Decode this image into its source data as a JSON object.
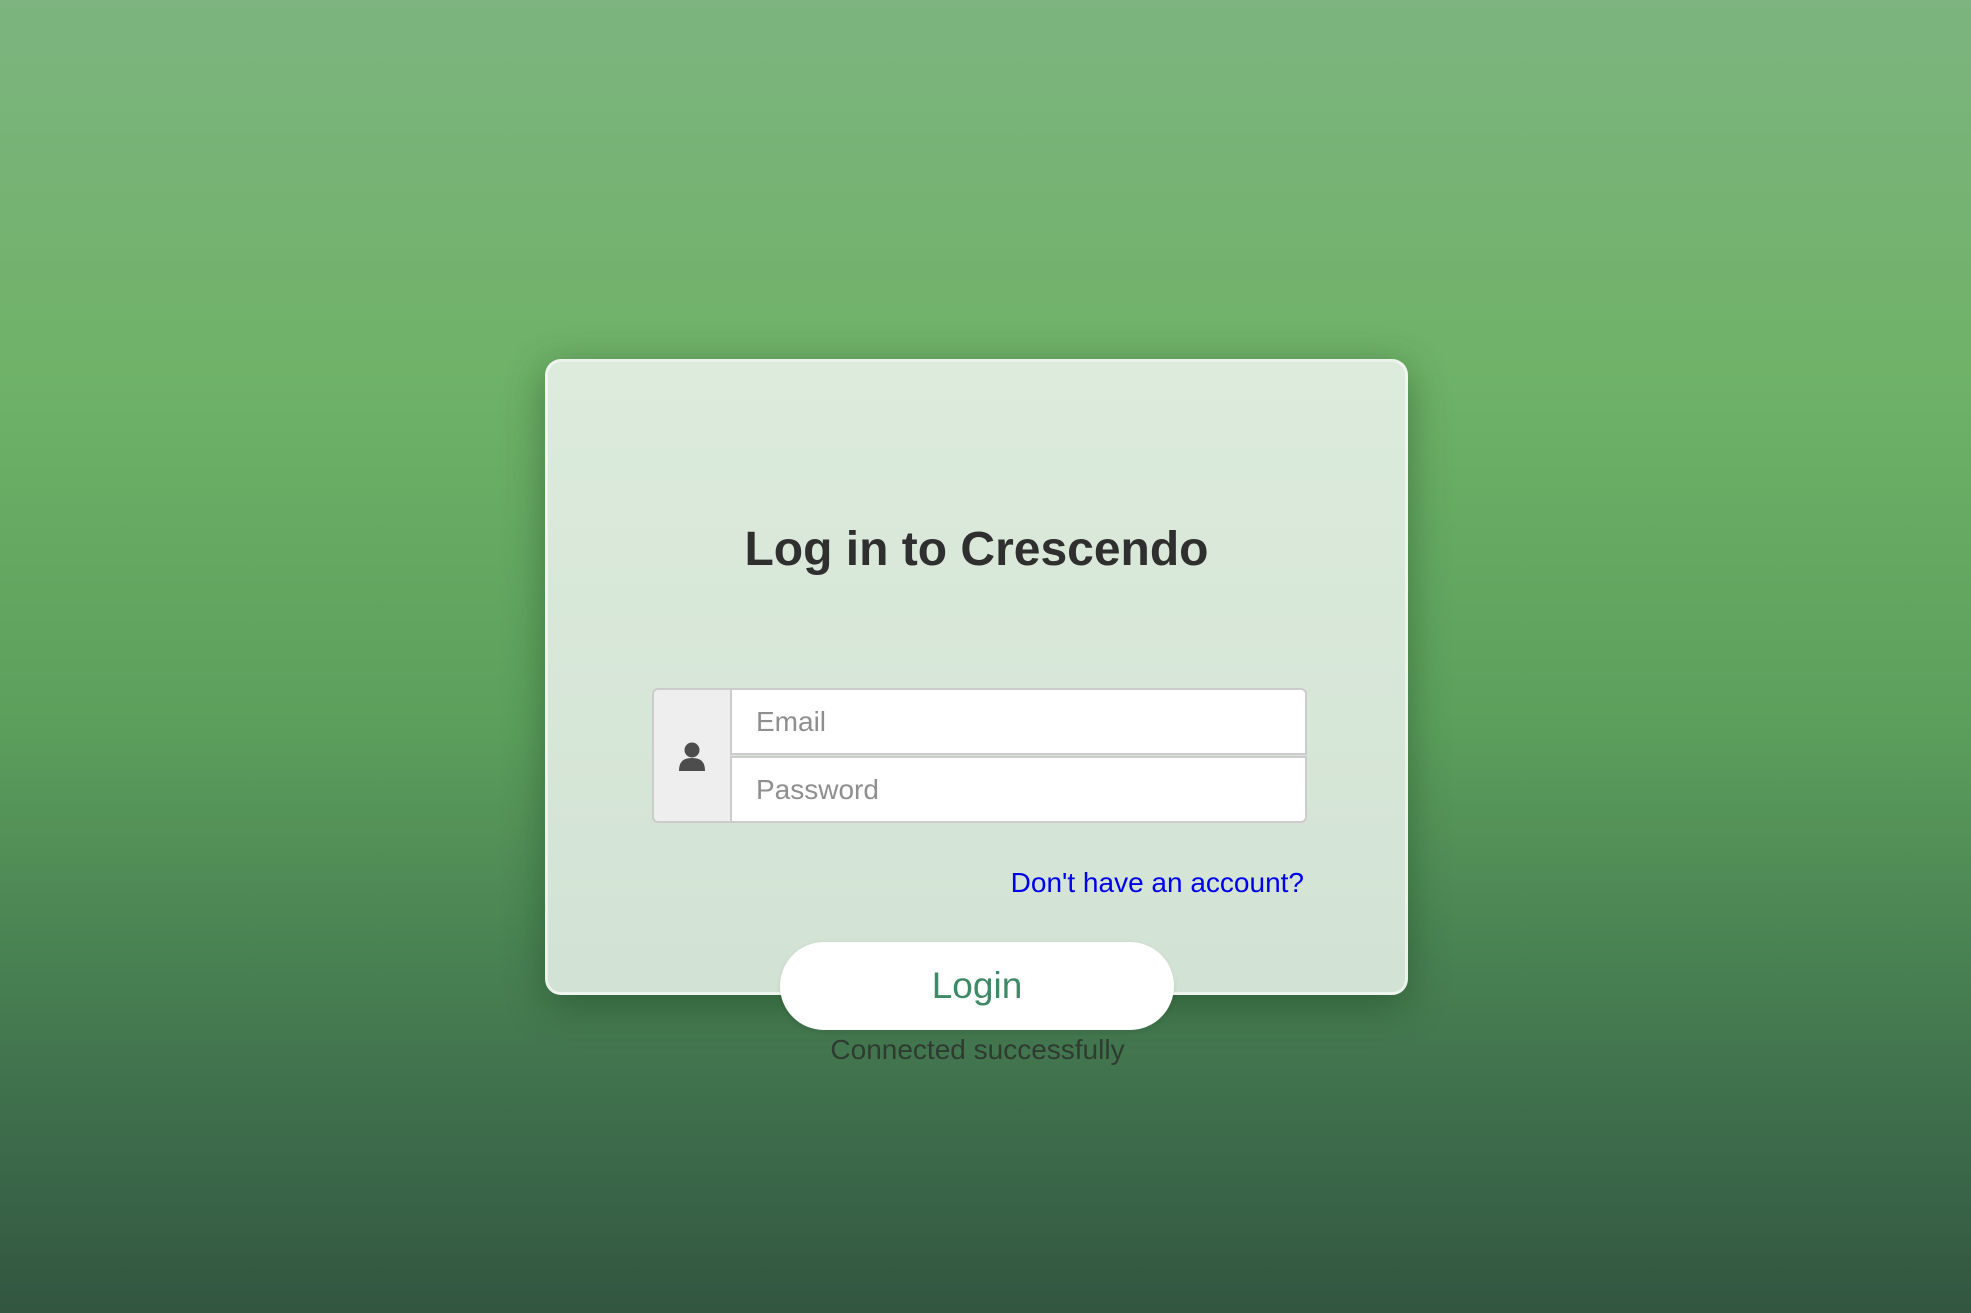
{
  "login_card": {
    "title": "Log in to Crescendo",
    "user_icon": "user-icon",
    "email": {
      "value": "",
      "placeholder": "Email"
    },
    "password": {
      "value": "",
      "placeholder": "Password"
    },
    "signup_link": "Don't have an account?"
  },
  "login_button_label": "Login",
  "status_message": "Connected successfully",
  "colors": {
    "background_top": "#7db47f",
    "background_bottom": "#325640",
    "card_background": "#dcebdb",
    "link": "#0000ee",
    "button_text": "#3f8a66",
    "button_background": "#ffffff"
  }
}
